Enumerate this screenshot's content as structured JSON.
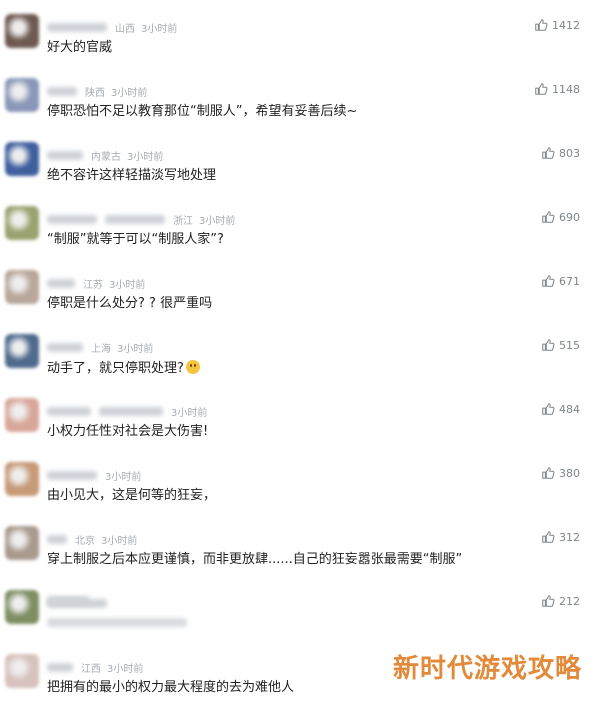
{
  "comments": [
    {
      "region": "山西",
      "time": "3小时前",
      "text": "好大的官威",
      "likes": "1412",
      "avatar_color": "#6e5a52"
    },
    {
      "region": "陕西",
      "time": "3小时前",
      "text": "停职恐怕不足以教育那位“制服人”，希望有妥善后续~",
      "likes": "1148",
      "avatar_color": "#8a97b8"
    },
    {
      "region": "内蒙古",
      "time": "3小时前",
      "text": "绝不容许这样轻描淡写地处理",
      "likes": "803",
      "avatar_color": "#3f5f9e"
    },
    {
      "region": "浙江",
      "time": "3小时前",
      "text": "“制服”就等于可以“制服人家”?",
      "likes": "690",
      "avatar_color": "#9aa36f"
    },
    {
      "region": "江苏",
      "time": "3小时前",
      "text": "停职是什么处分? ? 很严重吗",
      "likes": "671",
      "avatar_color": "#b8a79a"
    },
    {
      "region": "上海",
      "time": "3小时前",
      "text": "动手了，就只停职处理?",
      "likes": "515",
      "avatar_color": "#4f6a8c",
      "emoji": true
    },
    {
      "region": "",
      "time": "3小时前",
      "text": "小权力任性对社会是大伤害!",
      "likes": "484",
      "avatar_color": "#d9a79a"
    },
    {
      "region": "",
      "time": "3小时前",
      "text": "由小见大，这是何等的狂妄，",
      "likes": "380",
      "avatar_color": "#c79a78"
    },
    {
      "region": "北京",
      "time": "3小时前",
      "text": "穿上制服之后本应更谨慎，而非更放肆......自己的狂妄嚣张最需要“制服”",
      "likes": "312",
      "avatar_color": "#a99a8e"
    },
    {
      "region": "",
      "time": "",
      "text": "",
      "likes": "212",
      "avatar_color": "#7f8f63"
    },
    {
      "region": "江西",
      "time": "3小时前",
      "text": "把拥有的最小的权力最大程度的去为难他人",
      "likes": "",
      "avatar_color": "#d7c2bd"
    }
  ],
  "watermark": "新时代游戏攻略"
}
